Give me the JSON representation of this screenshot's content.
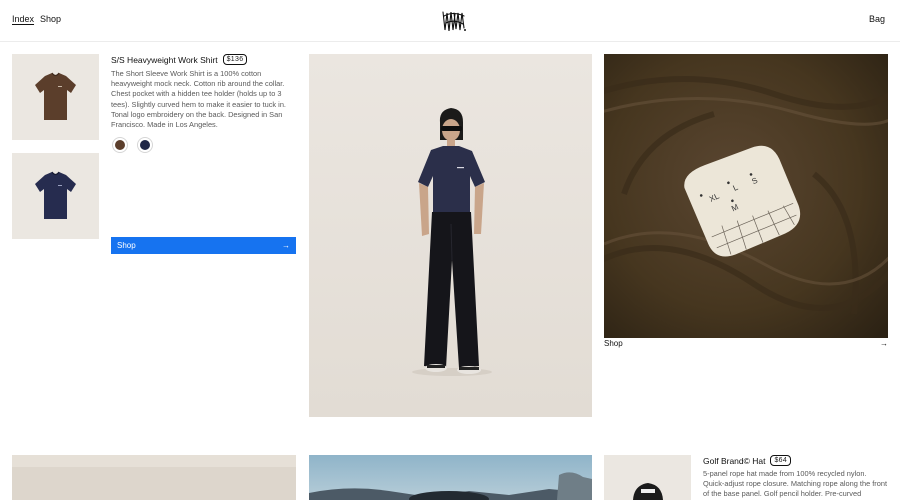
{
  "header": {
    "nav": [
      {
        "label": "Index",
        "active": true
      },
      {
        "label": "Shop",
        "active": false
      }
    ],
    "bag_label": "Bag",
    "logo_icon": "brand-logo-icon"
  },
  "product_1": {
    "title": "S/S Heavyweight Work Shirt",
    "price": "$136",
    "description": "The Short Sleeve Work Shirt is a 100% cotton heavyweight mock neck. Cotton rib around the collar. Chest pocket with a hidden tee holder (holds up to 3 tees). Slightly curved hem to make it easier to tuck in. Tonal logo embroidery on the back. Designed in San Francisco. Made in Los Angeles.",
    "swatches": [
      {
        "name": "brown",
        "color": "#5b3e2b"
      },
      {
        "name": "navy",
        "color": "#1f2747"
      }
    ],
    "shop_button": {
      "label": "Shop",
      "icon": "arrow-right-icon"
    }
  },
  "detail_photo": {
    "shop_label": "Shop",
    "icon": "arrow-right-icon"
  },
  "product_2": {
    "title": "Golf Brand© Hat",
    "price": "$64",
    "description": "5-panel rope hat made from 100% recycled nylon. Quick-adjust rope closure. Matching rope along the front of the base panel. Golf pencil holder. Pre-curved"
  },
  "colors": {
    "accent": "#1673f0",
    "thumb_bg": "#ebe7e1",
    "shirt_brown": "#5b3e2b",
    "shirt_navy": "#262c4f"
  }
}
